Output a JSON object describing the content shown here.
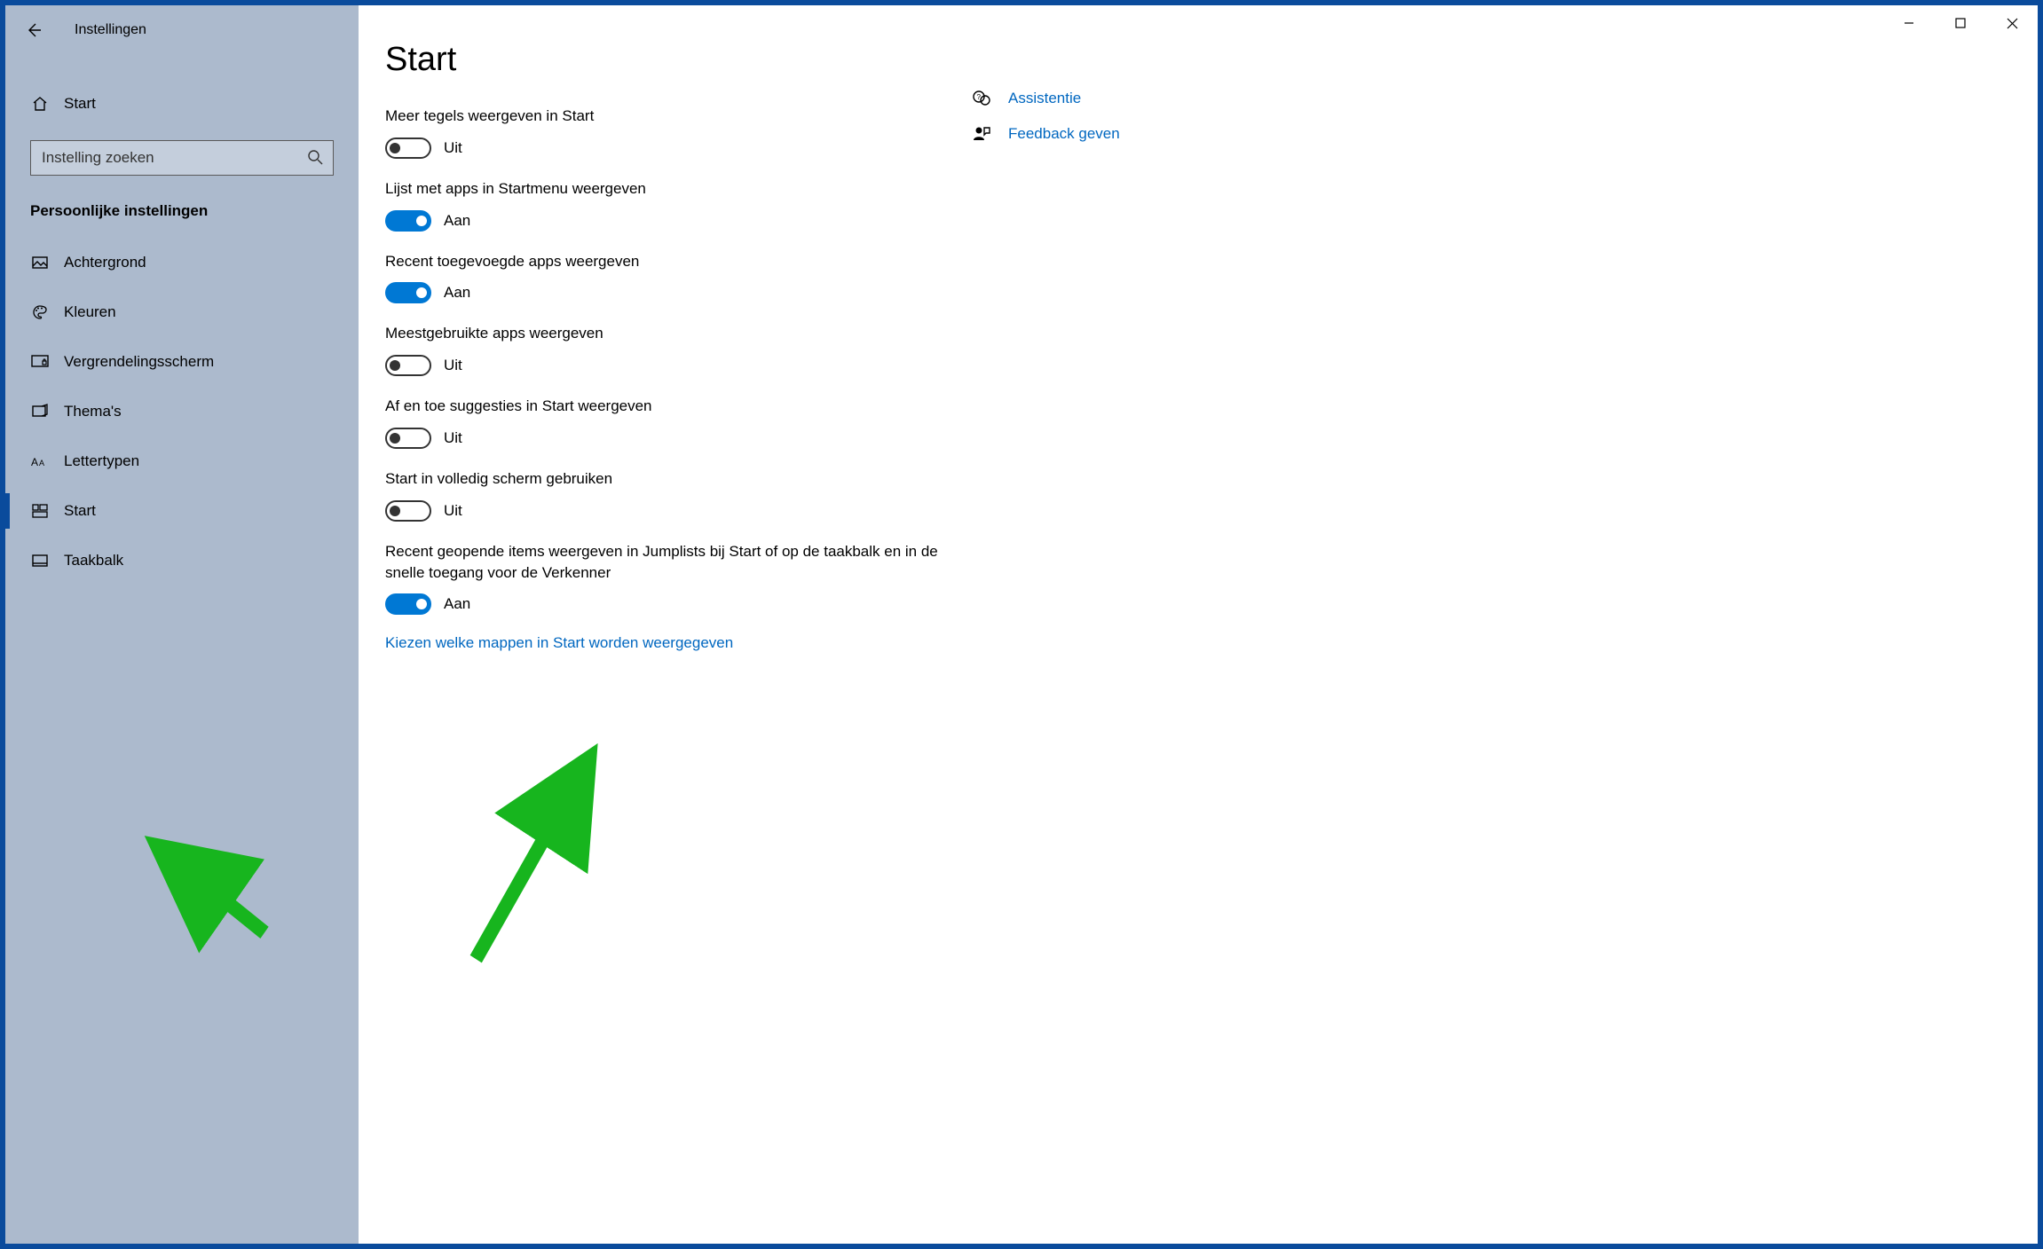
{
  "window": {
    "title": "Instellingen"
  },
  "sidebar": {
    "home_label": "Start",
    "search_placeholder": "Instelling zoeken",
    "category_label": "Persoonlijke instellingen",
    "items": [
      {
        "label": "Achtergrond"
      },
      {
        "label": "Kleuren"
      },
      {
        "label": "Vergrendelingsscherm"
      },
      {
        "label": "Thema's"
      },
      {
        "label": "Lettertypen"
      },
      {
        "label": "Start"
      },
      {
        "label": "Taakbalk"
      }
    ]
  },
  "page": {
    "title": "Start",
    "state_on": "Aan",
    "state_off": "Uit",
    "settings": [
      {
        "label": "Meer tegels weergeven in Start",
        "on": false
      },
      {
        "label": "Lijst met apps in Startmenu weergeven",
        "on": true
      },
      {
        "label": "Recent toegevoegde apps weergeven",
        "on": true
      },
      {
        "label": "Meestgebruikte apps weergeven",
        "on": false
      },
      {
        "label": "Af en toe suggesties in Start weergeven",
        "on": false
      },
      {
        "label": "Start in volledig scherm gebruiken",
        "on": false
      },
      {
        "label": "Recent geopende items weergeven in Jumplists bij Start of op de taakbalk en in de snelle toegang voor de Verkenner",
        "on": true
      }
    ],
    "link": "Kiezen welke mappen in Start worden weergegeven"
  },
  "help": {
    "assist_label": "Assistentie",
    "feedback_label": "Feedback geven"
  }
}
